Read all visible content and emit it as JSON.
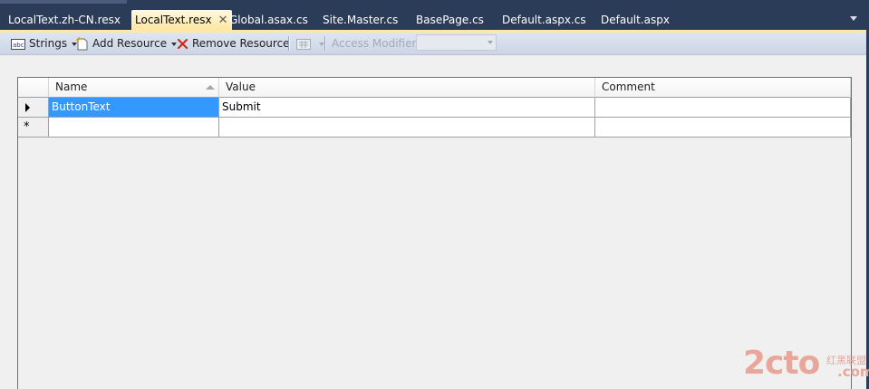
{
  "tabs": [
    {
      "label": "LocalText.zh-CN.resx",
      "active": false
    },
    {
      "label": "LocalText.resx",
      "active": true
    },
    {
      "label": "Global.asax.cs",
      "active": false
    },
    {
      "label": "Site.Master.cs",
      "active": false
    },
    {
      "label": "BasePage.cs",
      "active": false
    },
    {
      "label": "Default.aspx.cs",
      "active": false
    },
    {
      "label": "Default.aspx",
      "active": false
    }
  ],
  "toolbar": {
    "strings_label": "Strings",
    "add_resource_label": "Add Resource",
    "remove_resource_label": "Remove Resource",
    "access_modifier_label": "Access Modifier:",
    "access_modifier_value": ""
  },
  "grid": {
    "columns": [
      "Name",
      "Value",
      "Comment"
    ],
    "rows": [
      {
        "name": "ButtonText",
        "value": "Submit",
        "comment": ""
      },
      {
        "name": "",
        "value": "",
        "comment": ""
      }
    ],
    "new_row_marker": "*"
  },
  "watermark": {
    "main": "2cto",
    "cn": "红黑联盟",
    "suffix": ".com"
  },
  "colors": {
    "accent_tab": "#ffe8a6",
    "selection": "#3399ff",
    "chrome_bg": "#2b3c59"
  }
}
